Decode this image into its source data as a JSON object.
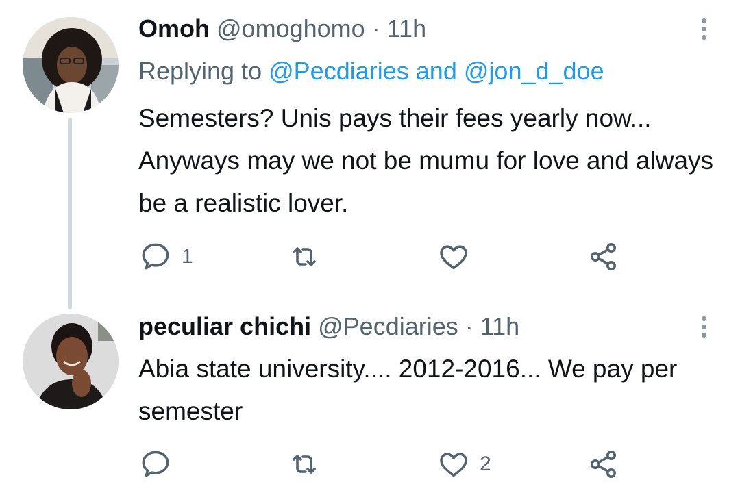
{
  "tweets": [
    {
      "name": "Omoh",
      "handle": "@omoghomo",
      "separator": "·",
      "time": "11h",
      "replying_prefix": "Replying to",
      "replying_mention_1": "@Pecdiaries",
      "replying_and": "and",
      "replying_mention_2": "@jon_d_doe",
      "text": "Semesters? Unis pays their fees yearly now... Anyways may we not be mumu for love and always be a realistic lover.",
      "reply_count": "1",
      "retweet_count": "",
      "like_count": ""
    },
    {
      "name": "peculiar chichi",
      "handle": "@Pecdiaries",
      "separator": "·",
      "time": "11h",
      "text": "Abia state university.... 2012-2016... We pay per semester",
      "reply_count": "",
      "retweet_count": "",
      "like_count": "2"
    }
  ],
  "icons": {
    "reply": "reply-icon",
    "retweet": "retweet-icon",
    "like": "heart-icon",
    "share": "share-icon",
    "more": "more-vertical-icon"
  },
  "colors": {
    "text": "#0f1419",
    "secondary": "#536471",
    "accent": "#1d9bf0",
    "thread_line": "#cfd9de"
  }
}
